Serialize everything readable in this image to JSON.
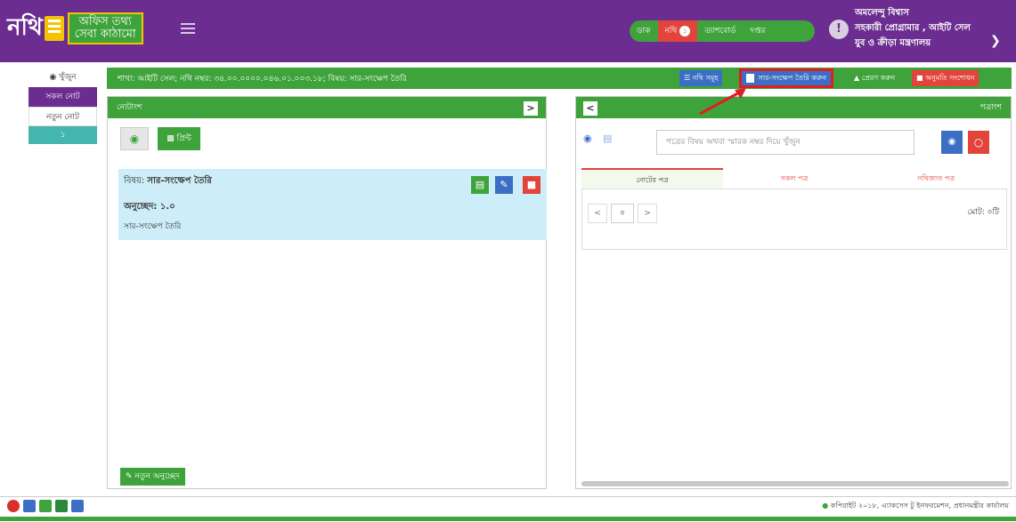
{
  "header": {
    "logo_nothi": "নথি",
    "logo_line1": "অফিস তথ্য",
    "logo_line2": "সেবা কাঠামো",
    "nav": [
      "ডাক",
      "নথি",
      "ড্যাশবোর্ড",
      "দপ্তর"
    ],
    "nothi_badge": "১",
    "user_name": "অমলেন্দু বিশ্বাস",
    "user_role": "সহকারী প্রোগ্রামার , আইটি সেল",
    "user_office": "যুব ও ক্রীড়া মন্ত্রণালয়"
  },
  "sidebar": {
    "search": "খুঁজুন",
    "all_notes": "সকল নোট",
    "new_note": "নতুন নোট",
    "note_number": "১"
  },
  "infobar": {
    "text": "শাখা: আইটি সেল; নথি নম্বর: ৩৪.০০.০০০০.০৪৬.০১.০০৩.১৮; বিষয়: সার-সংক্ষেপ তৈরি",
    "btn_nothi": "নথি সমূহ",
    "btn_summary": "সার-সংক্ষেপ তৈরি করুন",
    "btn_send": "প্রেরণ করুন",
    "btn_perm": "অনুমতি সংশোধন"
  },
  "left_panel": {
    "title": "নোটাংশ",
    "arrow": ">",
    "print": "প্রিন্ট",
    "subject_label": "বিষয়:",
    "subject": "সার-সংক্ষেপ তৈরি",
    "para": "অনুচ্ছেদ: ১.০",
    "text": "সার-সংক্ষেপ তৈরি",
    "new_para": "নতুন অনুচ্ছেদ"
  },
  "right_panel": {
    "title": "পত্রাংশ",
    "arrow": "<",
    "search_placeholder": "পত্রের বিষয় অথবা স্মারক নম্বর দিয়ে খুঁজুন",
    "tabs": [
      "নোটের পত্র",
      "সকল পত্র",
      "নথিজাত পত্র"
    ],
    "page_value": "০",
    "prev": "<",
    "next": ">",
    "total": "মোট: ০টি"
  },
  "footer": {
    "copyright": "কপিরাইট ২০১৮, এ্যাকসেস টু ইনফরমেশন, প্রধানমন্ত্রীর কার্যালয়"
  },
  "colors": {
    "purple": "#6b2d8f",
    "green": "#3ea33a",
    "blue": "#3b6fc6",
    "red": "#e2443b",
    "teal": "#45b5b0"
  }
}
